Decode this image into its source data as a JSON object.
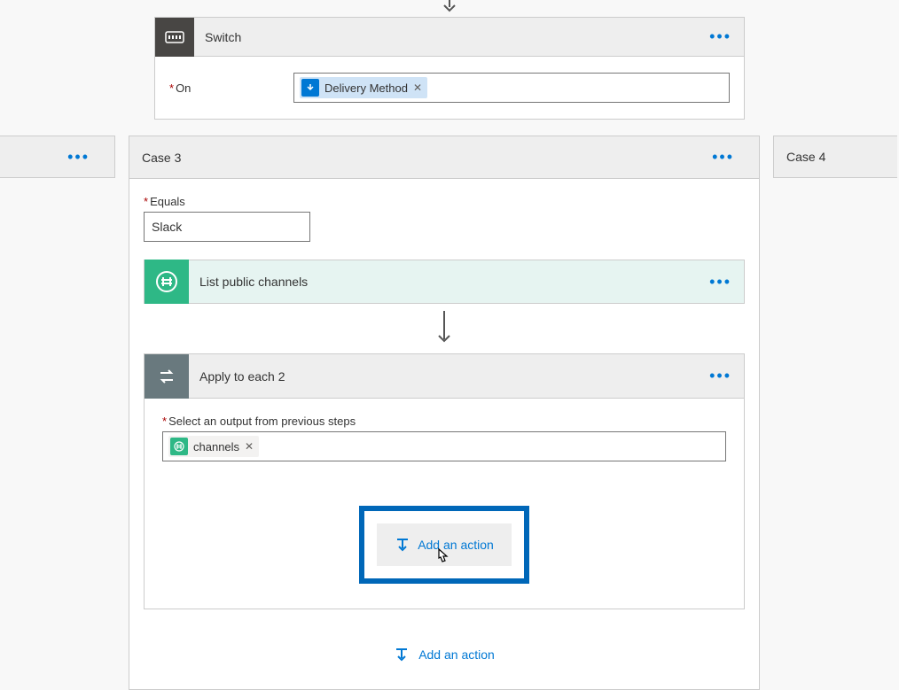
{
  "switch": {
    "title": "Switch",
    "on_label": "On",
    "token": "Delivery Method"
  },
  "case_left": {
    "title": ""
  },
  "case_main": {
    "title": "Case 3",
    "equals_label": "Equals",
    "equals_value": "Slack"
  },
  "case_right": {
    "title": "Case 4"
  },
  "slack_action": {
    "title": "List public channels"
  },
  "apply": {
    "title": "Apply to each 2",
    "select_label": "Select an output from previous steps",
    "token": "channels"
  },
  "add_action_inner": "Add an action",
  "add_action_outer": "Add an action"
}
